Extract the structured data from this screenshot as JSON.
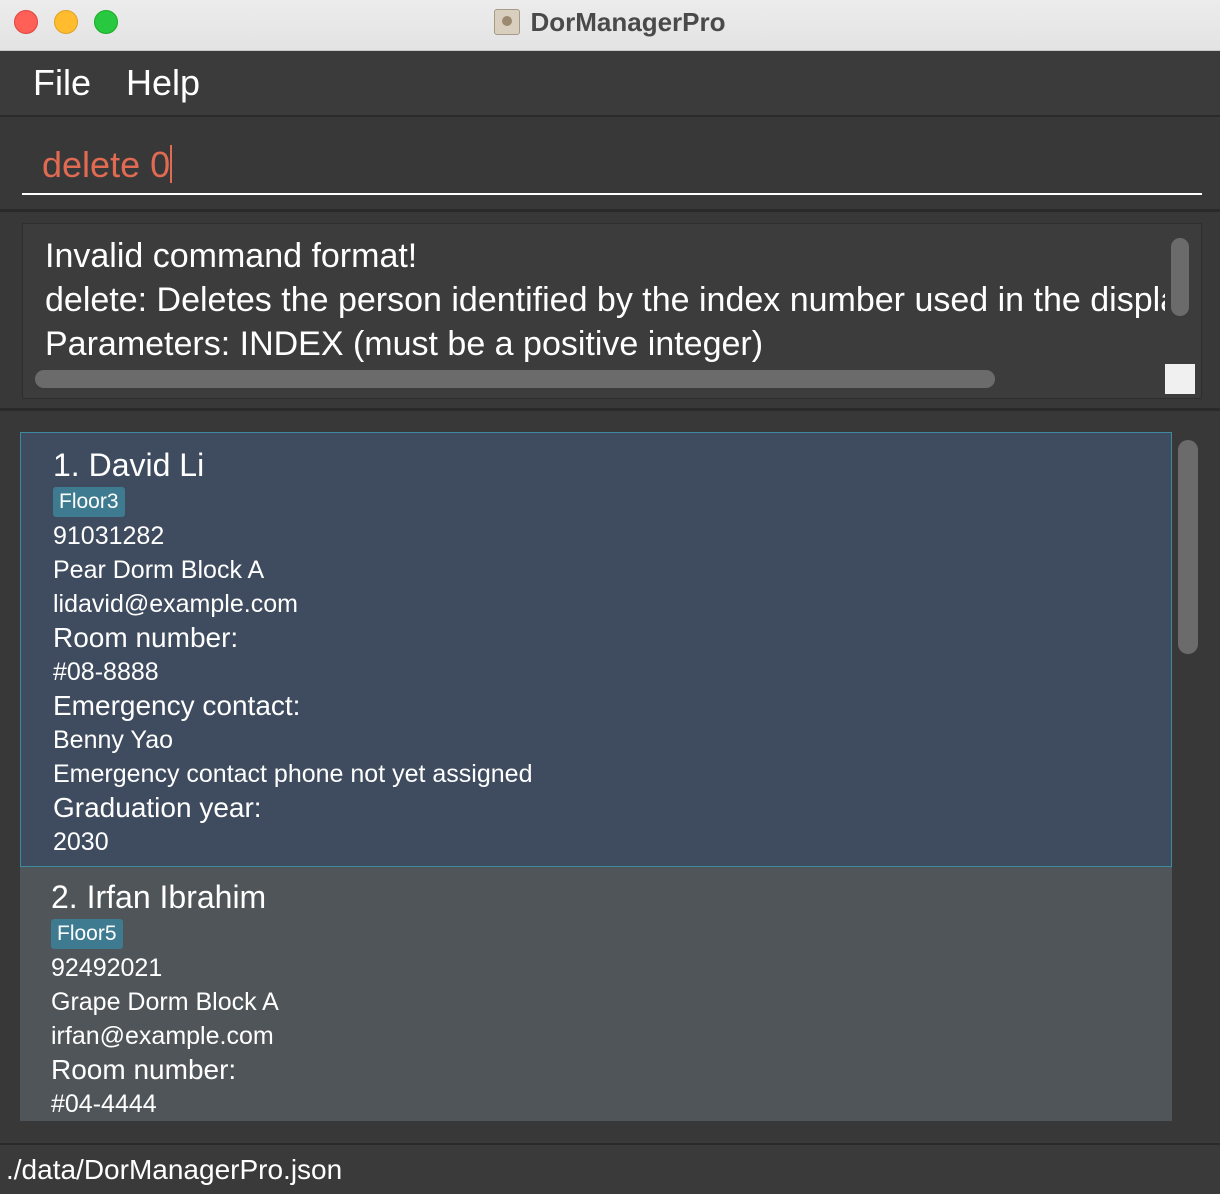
{
  "window": {
    "title": "DorManagerPro"
  },
  "menu": {
    "file": "File",
    "help": "Help"
  },
  "command": {
    "value": "delete 0"
  },
  "result": {
    "lines": [
      "Invalid command format!",
      "delete: Deletes the person identified by the index number used in the displayed person list.",
      "Parameters: INDEX (must be a positive integer)"
    ]
  },
  "persons": [
    {
      "name": "1. David Li",
      "tag": "Floor3",
      "phone": "91031282",
      "address": "Pear Dorm Block A",
      "email": "lidavid@example.com",
      "room_label": "Room number:",
      "room": "#08-8888",
      "emergency_label": "Emergency contact:",
      "emergency_name": "Benny Yao",
      "emergency_phone": "Emergency contact phone not yet assigned",
      "grad_label": "Graduation year:",
      "grad_year": "2030"
    },
    {
      "name": "2. Irfan Ibrahim",
      "tag": "Floor5",
      "phone": "92492021",
      "address": "Grape Dorm Block A",
      "email": "irfan@example.com",
      "room_label": "Room number:",
      "room": "#04-4444"
    }
  ],
  "status": {
    "file_path": "./data/DorManagerPro.json"
  },
  "colors": {
    "accent_input_text": "#e06a52",
    "selected_card": "#3f4c5f",
    "tag_bg": "#3e7b91"
  }
}
